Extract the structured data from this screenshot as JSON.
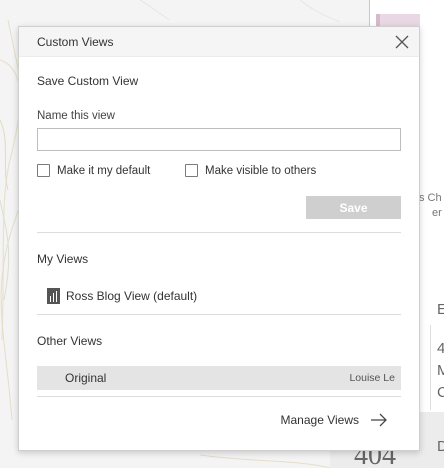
{
  "background": {
    "chart_caption_partial": "s Ch",
    "chart_caption_partial2": "er",
    "side_text_top": "E",
    "side_rows": [
      "4",
      "M",
      "C"
    ],
    "side_bottom_label": "D",
    "big_number": "404"
  },
  "dialog": {
    "title": "Custom Views",
    "close_icon": "close-icon",
    "save_section": {
      "heading": "Save Custom View",
      "name_label": "Name this view",
      "name_value": "",
      "name_placeholder": "",
      "default_checkbox_label": "Make it my default",
      "default_checked": false,
      "visible_checkbox_label": "Make visible to others",
      "visible_checked": false,
      "save_label": "Save"
    },
    "my_views": {
      "heading": "My Views",
      "items": [
        {
          "label": "Ross Blog View (default)",
          "icon": "bar-chart-icon"
        }
      ]
    },
    "other_views": {
      "heading": "Other Views",
      "items": [
        {
          "label": "Original",
          "owner": "Louise Le"
        }
      ]
    },
    "manage_label": "Manage Views",
    "manage_icon": "arrow-right-icon"
  },
  "colors": {
    "save_disabled_bg": "#cfcfcf",
    "selected_row_bg": "#e4e4e4",
    "header_bg": "#f5f5f5",
    "bar_pink": "#e9d7e4"
  }
}
